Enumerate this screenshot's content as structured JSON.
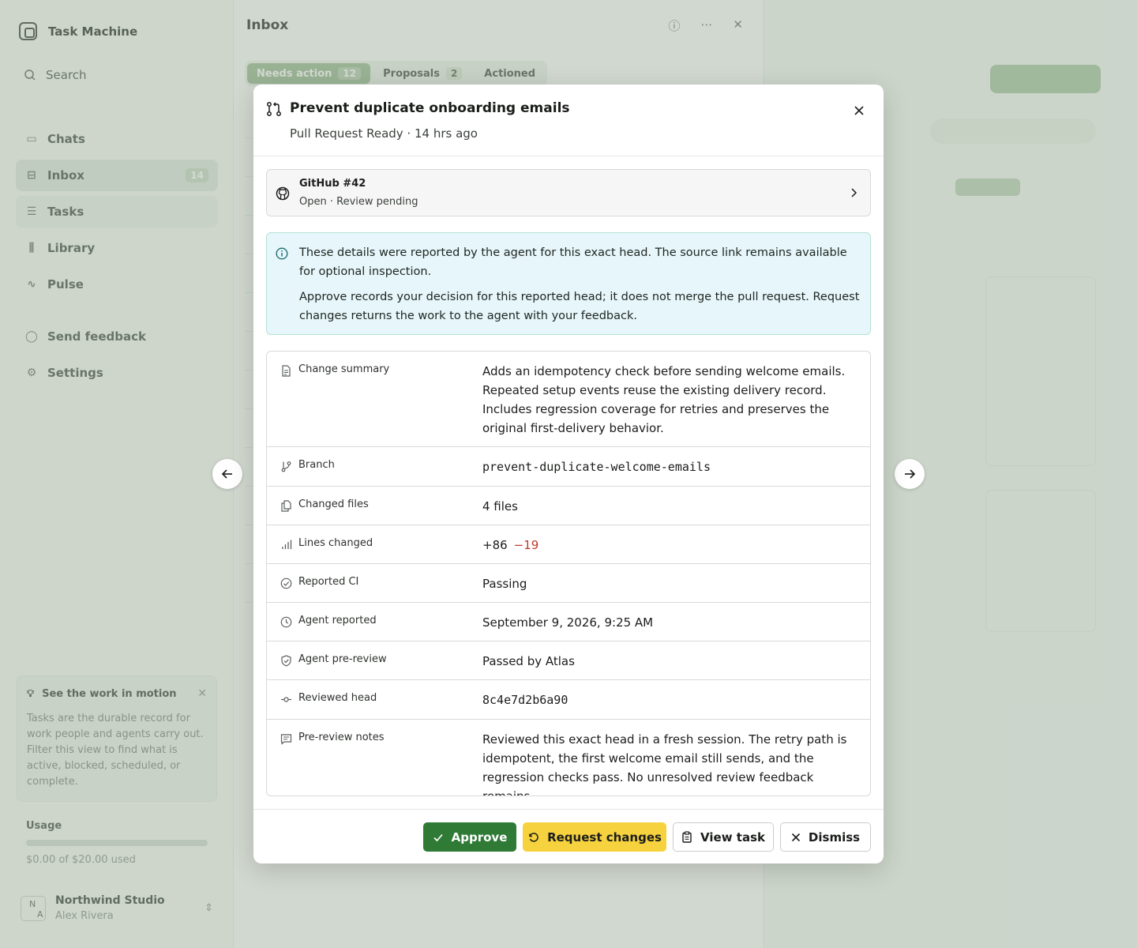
{
  "app": {
    "name": "Task Machine",
    "search_label": "Search",
    "nav": [
      {
        "label": "Chats",
        "icon": "chats-icon"
      },
      {
        "label": "Inbox",
        "icon": "inbox-icon",
        "count": "14"
      },
      {
        "label": "Tasks",
        "icon": "tasks-icon"
      },
      {
        "label": "Library",
        "icon": "library-icon"
      },
      {
        "label": "Pulse",
        "icon": "pulse-icon"
      }
    ],
    "nav_secondary": [
      {
        "label": "Send feedback",
        "icon": "feedback-icon"
      },
      {
        "label": "Settings",
        "icon": "gear-icon"
      }
    ],
    "tip": {
      "title": "See the work in motion",
      "body": "Tasks are the durable record for work people and agents carry out. Filter this view to find what is active, blocked, scheduled, or complete."
    },
    "usage": {
      "label": "Usage",
      "text": "$0.00 of $20.00 used",
      "fraction": 0.0
    },
    "account": {
      "initials_top": "N",
      "initials_bottom": "A",
      "org": "Northwind Studio",
      "user": "Alex Rivera"
    }
  },
  "inbox": {
    "title": "Inbox",
    "tabs": [
      {
        "label": "Needs action",
        "count": "12"
      },
      {
        "label": "Proposals",
        "count": "2"
      },
      {
        "label": "Actioned",
        "count": ""
      }
    ]
  },
  "modal": {
    "title": "Prevent duplicate onboarding emails",
    "subtitle": "Pull Request Ready · 14 hrs ago",
    "github": {
      "title": "GitHub #42",
      "status": "Open · Review pending"
    },
    "info": {
      "p1": "These details were reported by the agent for this exact head. The source link remains available for optional inspection.",
      "p2": "Approve records your decision for this reported head; it does not merge the pull request. Request changes returns the work to the agent with your feedback."
    },
    "details": {
      "change_summary": {
        "label": "Change summary",
        "value": "Adds an idempotency check before sending welcome emails. Repeated setup events reuse the existing delivery record. Includes regression coverage for retries and preserves the original first-delivery behavior."
      },
      "branch": {
        "label": "Branch",
        "value": "prevent-duplicate-welcome-emails"
      },
      "changed_files": {
        "label": "Changed files",
        "value": "4 files"
      },
      "lines_changed": {
        "label": "Lines changed",
        "added": "+86",
        "removed": "−19"
      },
      "reported_ci": {
        "label": "Reported CI",
        "value": "Passing"
      },
      "agent_reported": {
        "label": "Agent reported",
        "value": "September 9, 2026, 9:25 AM"
      },
      "agent_prereview": {
        "label": "Agent pre-review",
        "value": "Passed by Atlas"
      },
      "reviewed_head": {
        "label": "Reviewed head",
        "value": "8c4e7d2b6a90"
      },
      "prereview_notes": {
        "label": "Pre-review notes",
        "value": "Reviewed this exact head in a fresh session. The retry path is idempotent, the first welcome email still sends, and the regression checks pass. No unresolved review feedback remains."
      }
    },
    "actions": {
      "approve": "Approve",
      "request_changes": "Request changes",
      "view_task": "View task",
      "dismiss": "Dismiss"
    }
  },
  "colors": {
    "approve": "#2f7a35",
    "request_changes": "#f7d23f",
    "lines_removed": "#c0392b",
    "info_bg": "#e6f6fa"
  }
}
